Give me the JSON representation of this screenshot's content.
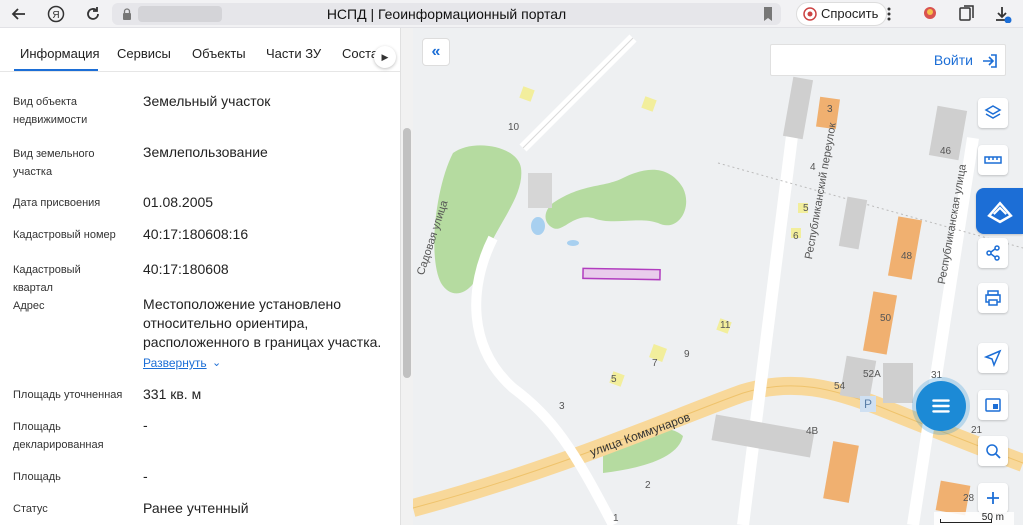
{
  "browser": {
    "page_title": "НСПД | Геоинформационный портал",
    "ask_button": "Спросить",
    "back_icon": "arrow-left-icon",
    "yandex_icon": "yandex-icon",
    "refresh_icon": "refresh-icon"
  },
  "tabs": [
    {
      "label": "Информация",
      "active": true
    },
    {
      "label": "Сервисы"
    },
    {
      "label": "Объекты"
    },
    {
      "label": "Части ЗУ"
    },
    {
      "label": "Соста"
    }
  ],
  "info": {
    "rows": [
      {
        "label": "Вид объекта недвижимости",
        "value": "Земельный участок"
      },
      {
        "label": "Вид земельного участка",
        "value": "Землепользование"
      },
      {
        "label": "Дата присвоения",
        "value": "01.08.2005"
      },
      {
        "label": "Кадастровый номер",
        "value": "40:17:180608:16"
      },
      {
        "label": "Кадастровый квартал",
        "value": "40:17:180608"
      },
      {
        "label": "Адрес",
        "value": "Местоположение установлено относительно ориентира, расположенного в границах участка."
      },
      {
        "label": "Площадь уточненная",
        "value": "331 кв. м"
      },
      {
        "label": "Площадь декларированная",
        "value": "-"
      },
      {
        "label": "Площадь",
        "value": "-"
      },
      {
        "label": "Статус",
        "value": "Ранее учтенный"
      }
    ],
    "expand_link": "Развернуть"
  },
  "map": {
    "login_label": "Войти",
    "scale_label": "50 m",
    "street_labels": {
      "sadovaya": "Садовая улица",
      "kommunarov": "улица Коммунаров",
      "respublikansky_per": "Республиканский переулок",
      "respublikanskaya": "Республиканская улица"
    },
    "house_numbers": [
      "10",
      "3",
      "4",
      "5",
      "6",
      "46",
      "48",
      "50",
      "11",
      "7",
      "9",
      "5",
      "3",
      "54",
      "52А",
      "31",
      "4В",
      "21",
      "2",
      "28",
      "1"
    ],
    "accent_color": "#1c6ed6",
    "parcel_color": "#b13dbf"
  },
  "tools": [
    "layers-icon",
    "ruler-icon",
    "cadastral-icon",
    "share-icon",
    "print-icon",
    "locate-icon",
    "split-view-icon",
    "search-location-icon",
    "zoom-in-icon"
  ]
}
